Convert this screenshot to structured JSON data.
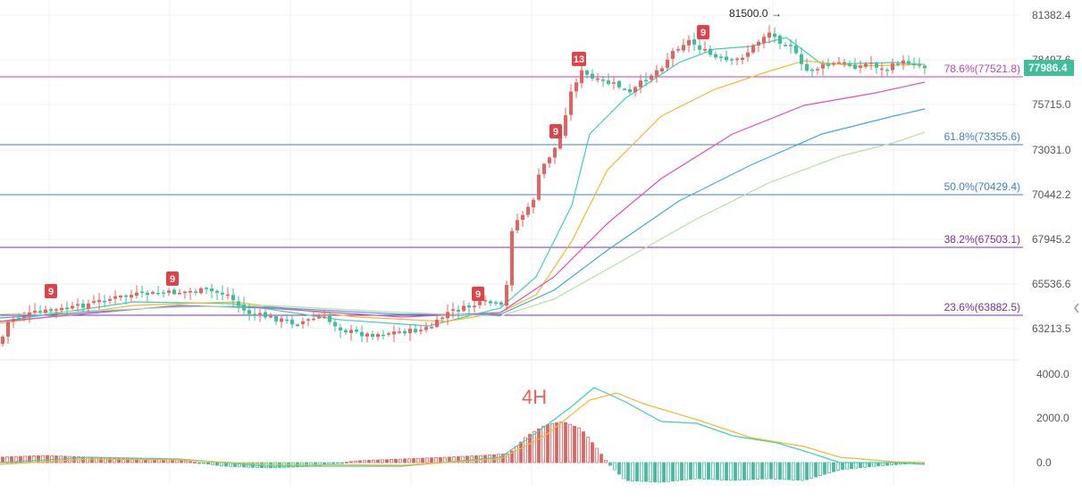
{
  "chart_data": {
    "type": "candlestick",
    "timeframe": "4H",
    "price_axis": {
      "ticks": [
        "81382.4",
        "78497.6",
        "75715.0",
        "73031.0",
        "70442.2",
        "67945.2",
        "65536.6",
        "63213.5"
      ]
    },
    "indicator_axis": {
      "ticks": [
        "4000.0",
        "2000.0",
        "0.0"
      ]
    },
    "last_price": "77986.4",
    "high_annotation": "81500.0",
    "fib_levels": [
      {
        "label": "78.6%(77521.8)",
        "value": 77521.8,
        "color": "#c040b8"
      },
      {
        "label": "61.8%(73355.6)",
        "value": 73355.6,
        "color": "#3d7dd8"
      },
      {
        "label": "50.0%(70429.4)",
        "value": 70429.4,
        "color": "#3d7dd8"
      },
      {
        "label": "38.2%(67503.1)",
        "value": 67503.1,
        "color": "#7a2fa0"
      },
      {
        "label": "23.6%(63882.5)",
        "value": 63882.5,
        "color": "#7a2fa0"
      }
    ],
    "td_markers": [
      "9",
      "9",
      "9",
      "13",
      "9",
      "9"
    ],
    "colors": {
      "up": "#e8615e",
      "down": "#3dbf9a",
      "ma_fast": "#3dcfb8",
      "ma_mid": "#f5b730",
      "ma_slow": "#e04fc4",
      "ma_slower": "#40a8e0",
      "ma_slowest": "#b8e0a0"
    }
  }
}
